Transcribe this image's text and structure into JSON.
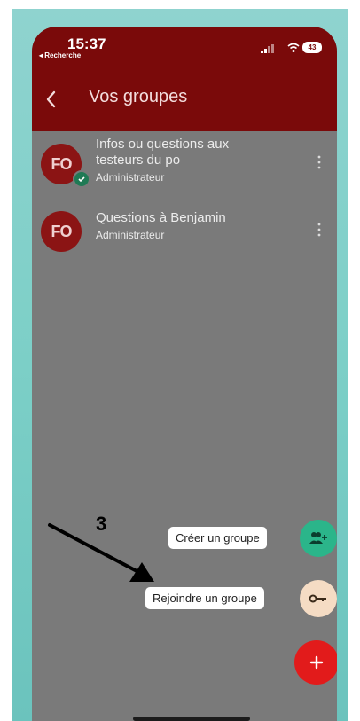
{
  "status_bar": {
    "time": "15:37",
    "back_label": "◂ Recherche",
    "battery": "43"
  },
  "header": {
    "title": "Vos groupes",
    "back_icon": "chevron-left-icon"
  },
  "groups": [
    {
      "avatar_text": "FO",
      "title_line1": "Infos ou questions aux",
      "title_line2": "testeurs du po",
      "role": "Administrateur",
      "has_check_badge": true
    },
    {
      "avatar_text": "FO",
      "title_line1": "Questions à Benjamin",
      "role": "Administrateur",
      "has_check_badge": false
    }
  ],
  "fab_menu": {
    "create_label": "Créer un groupe",
    "join_label": "Rejoindre un groupe",
    "create_icon": "add-group-icon",
    "join_icon": "key-icon",
    "main_icon": "plus-icon",
    "colors": {
      "create": "#2bb58a",
      "join": "#f5dcc4",
      "main": "#e21b1b"
    }
  },
  "annotation": {
    "number": "3"
  },
  "colors": {
    "header": "#7a0a0a",
    "overlay": "#7a7a7a",
    "background": "#8fd3cf"
  }
}
